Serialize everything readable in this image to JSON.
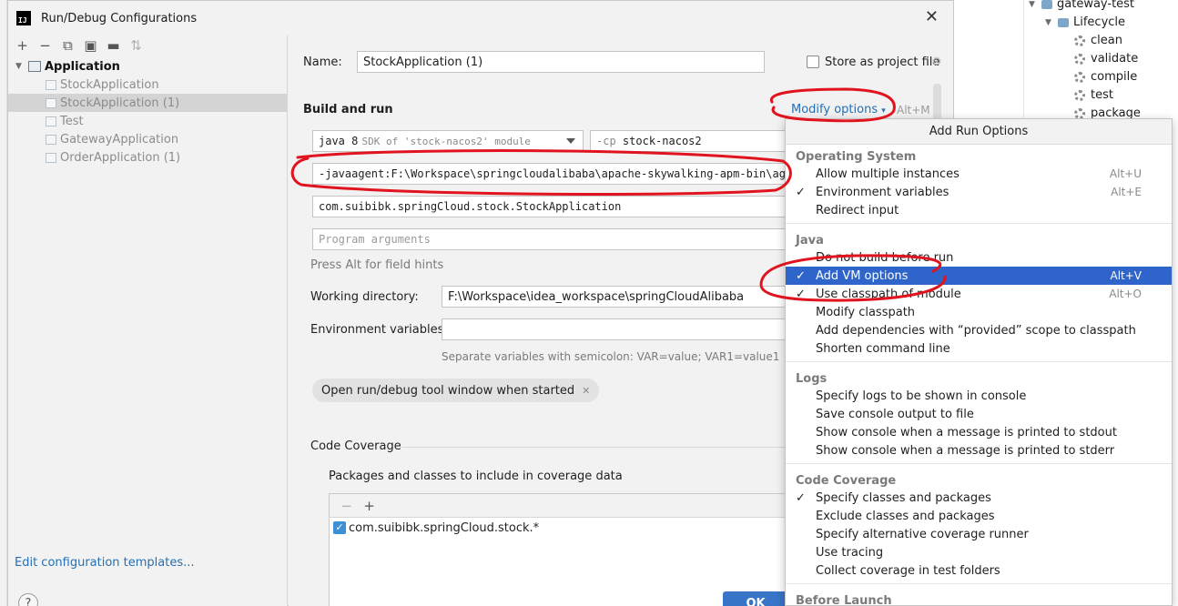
{
  "background": {
    "maven_tree": [
      {
        "label": "gateway-test",
        "level": 0,
        "icon": "folder-icon"
      },
      {
        "label": "Lifecycle",
        "level": 1,
        "icon": "folder-icon"
      },
      {
        "label": "clean",
        "level": 2,
        "icon": "gear-icon"
      },
      {
        "label": "validate",
        "level": 2,
        "icon": "gear-icon"
      },
      {
        "label": "compile",
        "level": 2,
        "icon": "gear-icon"
      },
      {
        "label": "test",
        "level": 2,
        "icon": "gear-icon"
      },
      {
        "label": "package",
        "level": 2,
        "icon": "gear-icon"
      }
    ]
  },
  "dialog": {
    "title": "Run/Debug Configurations",
    "toolbar_icons": [
      "add-icon",
      "remove-icon",
      "copy-icon",
      "save-icon",
      "folder-icon",
      "sort-icon"
    ],
    "tree": {
      "root": "Application",
      "children": [
        "StockApplication",
        "StockApplication (1)",
        "Test",
        "GatewayApplication",
        "OrderApplication (1)"
      ],
      "selected_index": 1
    },
    "edit_templates": "Edit configuration templates...",
    "help_label": "?",
    "ok_label": "OK"
  },
  "config": {
    "name_label": "Name:",
    "name_value": "StockApplication (1)",
    "store_label": "Store as project file",
    "build_and_run": "Build and run",
    "modify_options": "Modify options",
    "modify_shortcut": "Alt+M",
    "jdk": "java 8",
    "jdk_detail": "SDK of 'stock-nacos2' module",
    "cp_prefix": "-cp",
    "cp_value": "stock-nacos2",
    "vm_options": "-javaagent:F:\\Workspace\\springcloudalibaba\\apache-skywalking-apm-bin\\agent\\skywalking-agent.jar",
    "main_class": "com.suibibk.springCloud.stock.StockApplication",
    "program_args_placeholder": "Program arguments",
    "field_hint": "Press Alt for field hints",
    "working_dir_label": "Working directory:",
    "working_dir_value": "F:\\Workspace\\idea_workspace\\springCloudAlibaba",
    "env_label": "Environment variables:",
    "env_hint": "Separate variables with semicolon: VAR=value; VAR1=value1",
    "chip": "Open run/debug tool window when started",
    "coverage_title": "Code Coverage",
    "coverage_subtitle": "Packages and classes to include in coverage data",
    "coverage_item": "com.suibibk.springCloud.stock.*"
  },
  "popup": {
    "title": "Add Run Options",
    "groups": [
      {
        "header": "Operating System",
        "options": [
          {
            "label": "Allow multiple instances",
            "shortcut": "Alt+U",
            "checked": false
          },
          {
            "label": "Environment variables",
            "shortcut": "Alt+E",
            "checked": true
          },
          {
            "label": "Redirect input",
            "shortcut": "",
            "checked": false
          }
        ]
      },
      {
        "header": "Java",
        "options": [
          {
            "label": "Do not build before run",
            "shortcut": "",
            "checked": false
          },
          {
            "label": "Add VM options",
            "shortcut": "Alt+V",
            "checked": true,
            "highlighted": true
          },
          {
            "label": "Use classpath of module",
            "shortcut": "Alt+O",
            "checked": true
          },
          {
            "label": "Modify classpath",
            "shortcut": "",
            "checked": false
          },
          {
            "label": "Add dependencies with “provided” scope to classpath",
            "shortcut": "",
            "checked": false
          },
          {
            "label": "Shorten command line",
            "shortcut": "",
            "checked": false
          }
        ]
      },
      {
        "header": "Logs",
        "options": [
          {
            "label": "Specify logs to be shown in console",
            "shortcut": "",
            "checked": false
          },
          {
            "label": "Save console output to file",
            "shortcut": "",
            "checked": false
          },
          {
            "label": "Show console when a message is printed to stdout",
            "shortcut": "",
            "checked": false
          },
          {
            "label": "Show console when a message is printed to stderr",
            "shortcut": "",
            "checked": false
          }
        ]
      },
      {
        "header": "Code Coverage",
        "options": [
          {
            "label": "Specify classes and packages",
            "shortcut": "",
            "checked": true
          },
          {
            "label": "Exclude classes and packages",
            "shortcut": "",
            "checked": false
          },
          {
            "label": "Specify alternative coverage runner",
            "shortcut": "",
            "checked": false
          },
          {
            "label": "Use tracing",
            "shortcut": "",
            "checked": false
          },
          {
            "label": "Collect coverage in test folders",
            "shortcut": "",
            "checked": false
          }
        ]
      },
      {
        "header": "Before Launch",
        "options": []
      }
    ]
  },
  "colors": {
    "accent": "#2f65ca",
    "link": "#2470b3",
    "annotation": "#e0141e"
  }
}
